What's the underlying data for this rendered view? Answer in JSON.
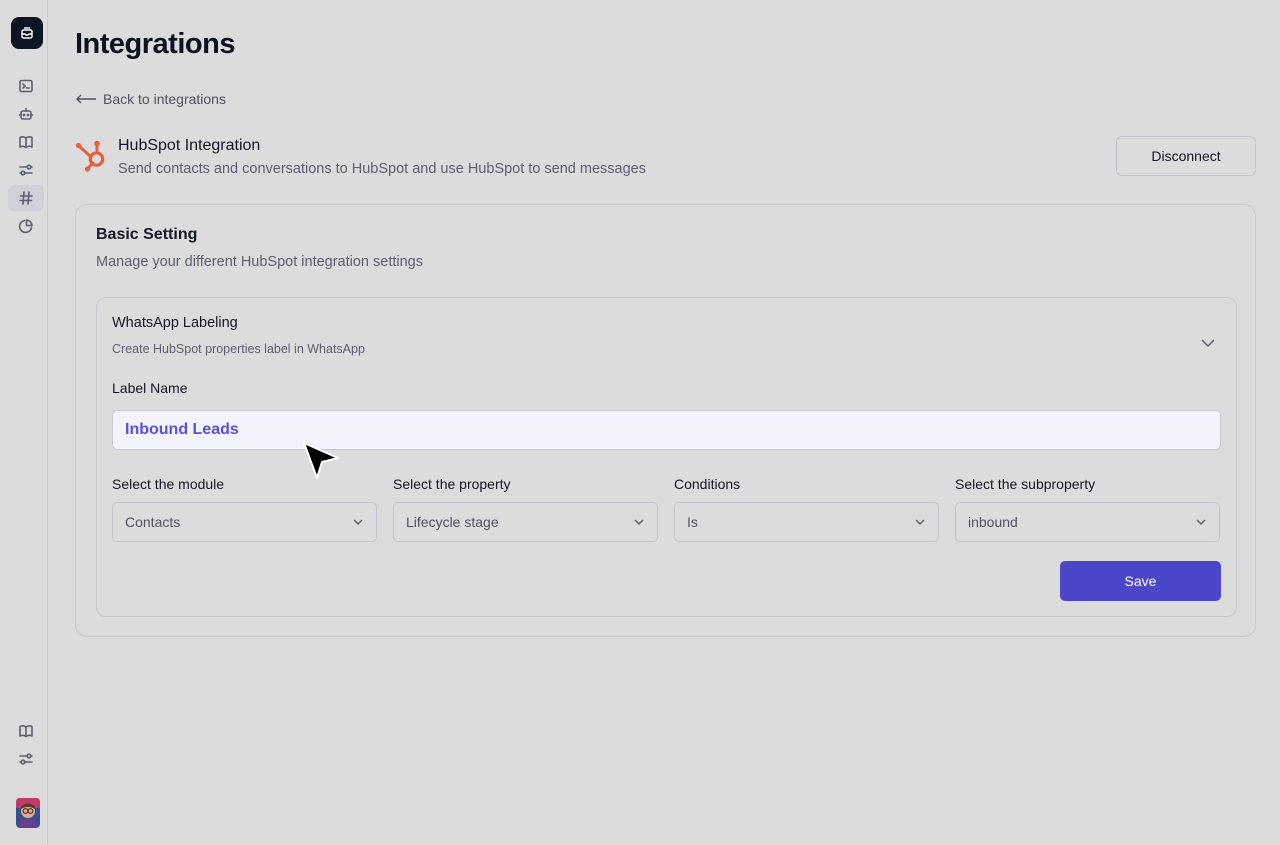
{
  "page": {
    "title": "Integrations"
  },
  "nav": {
    "back_label": "Back to integrations",
    "items": [
      {
        "icon": "terminal-icon"
      },
      {
        "icon": "bot-icon"
      },
      {
        "icon": "book-icon"
      },
      {
        "icon": "sliders-icon"
      },
      {
        "icon": "hash-icon",
        "active": true
      },
      {
        "icon": "pie-chart-icon"
      }
    ],
    "bottom_items": [
      {
        "icon": "book-icon"
      },
      {
        "icon": "sliders-icon"
      }
    ]
  },
  "integration": {
    "name": "HubSpot Integration",
    "description": "Send contacts and conversations to HubSpot and use HubSpot to send messages",
    "disconnect_label": "Disconnect",
    "brand_color": "#e2603d"
  },
  "basic_setting": {
    "title": "Basic Setting",
    "subtitle": "Manage your different HubSpot integration settings",
    "whatsapp_labeling": {
      "title": "WhatsApp Labeling",
      "subtitle": "Create HubSpot properties label in WhatsApp",
      "label_name_label": "Label Name",
      "label_name_value": "Inbound Leads",
      "fields": [
        {
          "label": "Select the module",
          "value": "Contacts"
        },
        {
          "label": "Select the property",
          "value": "Lifecycle stage"
        },
        {
          "label": "Conditions",
          "value": "Is"
        },
        {
          "label": "Select the subproperty",
          "value": "inbound"
        }
      ],
      "save_label": "Save"
    }
  },
  "colors": {
    "accent": "#4c46c9",
    "input_text": "#5651d8",
    "background": "#dcdcdc"
  }
}
